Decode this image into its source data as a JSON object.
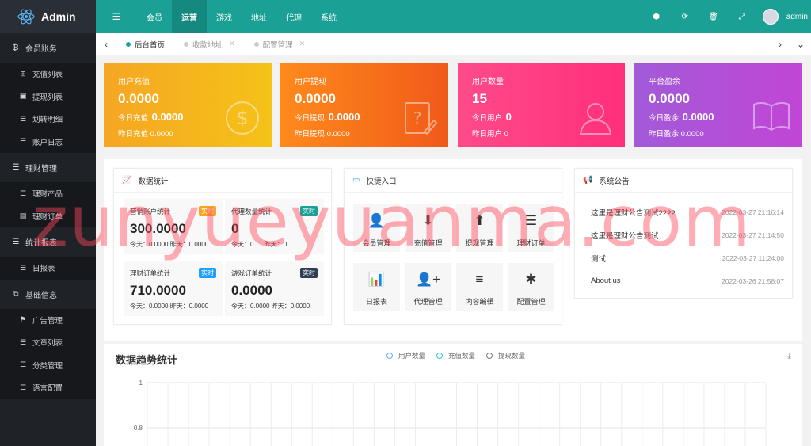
{
  "app": {
    "title": "Admin",
    "user": "admin"
  },
  "topnav": [
    "会员",
    "运营",
    "游戏",
    "地址",
    "代理",
    "系统"
  ],
  "tabs": [
    {
      "label": "后台首页"
    },
    {
      "label": "收款地址"
    },
    {
      "label": "配置管理"
    }
  ],
  "sidebar": [
    {
      "label": "会员账务",
      "items": [
        "充值列表",
        "提现列表",
        "划转明细",
        "账户日志"
      ]
    },
    {
      "label": "理财管理",
      "items": [
        "理财产品",
        "理财订单"
      ]
    },
    {
      "label": "统计报表",
      "items": [
        "日报表"
      ]
    },
    {
      "label": "基础信息",
      "items": [
        "广告管理",
        "文章列表",
        "分类管理",
        "语言配置"
      ]
    }
  ],
  "cards": [
    {
      "title": "用户充值",
      "value": "0.0000",
      "today_label": "今日充值",
      "today": "0.0000",
      "yest_label": "昨日充值",
      "yest": "0.0000"
    },
    {
      "title": "用户提现",
      "value": "0.0000",
      "today_label": "今日提现",
      "today": "0.0000",
      "yest_label": "昨日提现",
      "yest": "0.0000"
    },
    {
      "title": "用户数量",
      "value": "15",
      "today_label": "今日用户",
      "today": "0",
      "yest_label": "昨日用户",
      "yest": "0"
    },
    {
      "title": "平台盈余",
      "value": "0.0000",
      "today_label": "今日盈余",
      "today": "0.0000",
      "yest_label": "昨日盈余",
      "yest": "0.0000"
    }
  ],
  "stats_panel": {
    "title": "数据统计",
    "items": [
      {
        "title": "营销账户统计",
        "badge": "实时",
        "value": "300.0000",
        "today": "今天：0.0000",
        "yest": "昨天：0.0000"
      },
      {
        "title": "代理数量统计",
        "badge": "实时",
        "value": "0",
        "today": "今天：0",
        "yest": "昨天：0"
      },
      {
        "title": "理财订单统计",
        "badge": "实时",
        "value": "710.0000",
        "today": "今天：0.0000",
        "yest": "昨天：0.0000"
      },
      {
        "title": "游戏订单统计",
        "badge": "实时",
        "value": "0.0000",
        "today": "今天：0.0000",
        "yest": "昨天：0.0000"
      }
    ]
  },
  "quick": {
    "title": "快捷入口",
    "items": [
      "会员管理",
      "充值管理",
      "提现管理",
      "理财订单",
      "日报表",
      "代理管理",
      "内容编辑",
      "配置管理"
    ]
  },
  "notice": {
    "title": "系统公告",
    "items": [
      {
        "text": "这里是理财公告测试2222...",
        "date": "2022-03-27 21:16:14"
      },
      {
        "text": "这里是理财公告测试",
        "date": "2022-03-27 21:14:50"
      },
      {
        "text": "测试",
        "date": "2022-03-27 11:24:00"
      },
      {
        "text": "About us",
        "date": "2022-03-26 21:58:07"
      }
    ]
  },
  "trend": {
    "title": "数据趋势统计"
  },
  "chart_data": {
    "type": "line",
    "title": "数据趋势统计",
    "series": [
      {
        "name": "用户数量",
        "values": []
      },
      {
        "name": "充值数量",
        "values": []
      },
      {
        "name": "提现数量",
        "values": []
      }
    ],
    "yticks": [
      "1",
      "0.8"
    ],
    "ylim": [
      0,
      1
    ],
    "grid": true,
    "legend": "top-center",
    "colors": [
      "#5ab1ef",
      "#2ec7c9",
      "#777777"
    ]
  },
  "watermark": "zunyueyuanma.com"
}
